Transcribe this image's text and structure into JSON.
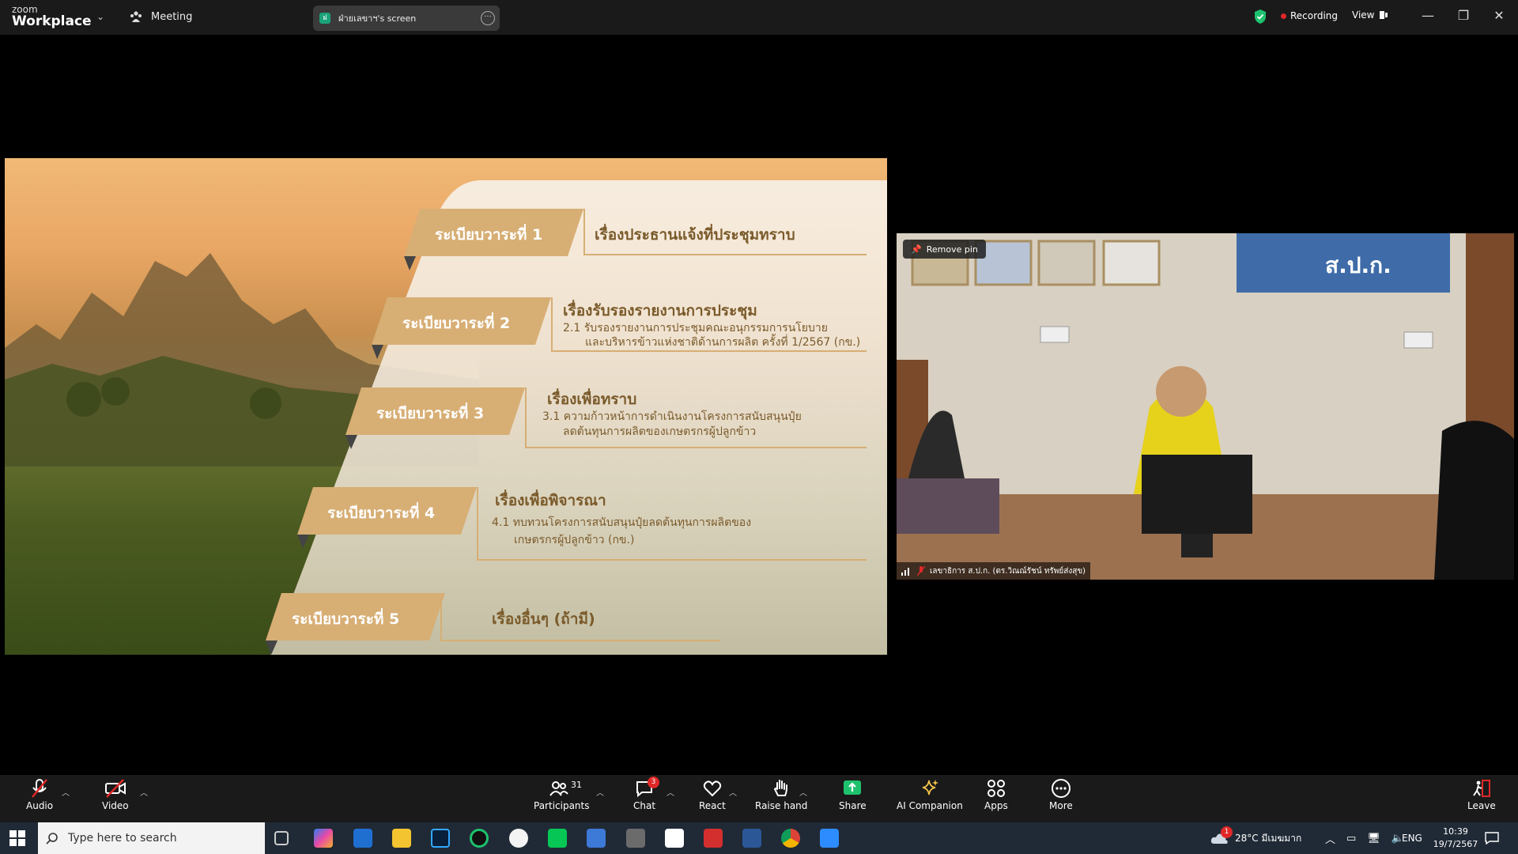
{
  "app": {
    "logo_top": "zoom",
    "logo_bottom": "Workplace",
    "meeting_label": "Meeting"
  },
  "share": {
    "label": "ฝ่ายเลขาฯ's screen",
    "icon_text": "ฝ"
  },
  "status": {
    "recording": "Recording",
    "view": "View"
  },
  "window": {
    "minimize": "—",
    "restore": "❐",
    "close": "✕"
  },
  "slide": {
    "items": [
      {
        "label": "ระเบียบวาระที่  1",
        "title": "เรื่องประธานแจ้งที่ประชุมทราบ",
        "sub1": "",
        "sub2": ""
      },
      {
        "label": "ระเบียบวาระที่  2",
        "title": "เรื่องรับรองรายงานการประชุม",
        "sub1": "2.1 รับรองรายงานการประชุมคณะอนุกรรมการนโยบาย",
        "sub2": "และบริหารข้าวแห่งชาติด้านการผลิต ครั้งที่ 1/2567 (กข.)"
      },
      {
        "label": "ระเบียบวาระที่  3",
        "title": "เรื่องเพื่อทราบ",
        "sub1": "3.1 ความก้าวหน้าการดำเนินงานโครงการสนับสนุนปุ๋ย",
        "sub2": "ลดต้นทุนการผลิตของเกษตรกรผู้ปลูกข้าว"
      },
      {
        "label": "ระเบียบวาระที่  4",
        "title": "เรื่องเพื่อพิจารณา",
        "sub1": "4.1 ทบทวนโครงการสนับสนุนปุ๋ยลดต้นทุนการผลิตของ",
        "sub2": "เกษตรกรผู้ปลูกข้าว (กข.)"
      },
      {
        "label": "ระเบียบวาระที่  5",
        "title": "เรื่องอื่นๆ (ถ้ามี)",
        "sub1": "",
        "sub2": ""
      }
    ]
  },
  "video": {
    "remove_pin": "Remove pin",
    "participant_name": "เลขาธิการ ส.ป.ก. (ดร.วิณณ์รัชน์ ทรัพย์ส่งสุข)",
    "wall_sign": "ส.ป.ก."
  },
  "toolbar": {
    "audio": "Audio",
    "video": "Video",
    "participants": "Participants",
    "participants_count": "31",
    "chat": "Chat",
    "chat_badge": "3",
    "react": "React",
    "raise_hand": "Raise hand",
    "share": "Share",
    "ai_companion": "AI Companion",
    "apps": "Apps",
    "more": "More",
    "leave": "Leave"
  },
  "taskbar": {
    "search_placeholder": "Type here to search",
    "weather": "28°C  มีเมฆมาก",
    "weather_badge": "1",
    "language": "ENG",
    "time": "10:39",
    "date": "19/7/2567"
  },
  "colors": {
    "toolbar_bg": "#1a1a1a",
    "share_green": "#1ec26e",
    "record_red": "#e02828",
    "slide_gold": "#d7ae74",
    "slide_brown": "#7a5a2a"
  }
}
